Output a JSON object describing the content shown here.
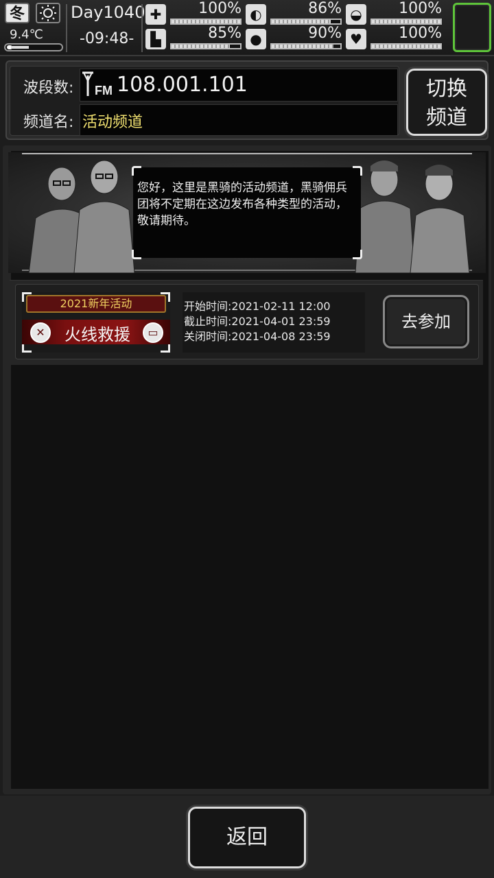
{
  "status": {
    "season": "冬",
    "weather_icon": "sun-icon",
    "temperature": "9.4℃",
    "thermometer_level": 0.3,
    "day": "Day1040",
    "time": "-09:48-",
    "stats": [
      {
        "name": "health",
        "icon": "first-aid-icon",
        "glyph": "✚",
        "value": "100%",
        "level": 1.0
      },
      {
        "name": "hunger",
        "icon": "stomach-icon",
        "glyph": "◐",
        "value": "86%",
        "level": 0.86
      },
      {
        "name": "medicine",
        "icon": "pill-icon",
        "glyph": "◒",
        "value": "100%",
        "level": 1.0
      },
      {
        "name": "stamina",
        "icon": "foot-icon",
        "glyph": "▙",
        "value": "85%",
        "level": 0.85
      },
      {
        "name": "thirst",
        "icon": "water-drop-icon",
        "glyph": "●",
        "value": "90%",
        "level": 0.9
      },
      {
        "name": "mood",
        "icon": "heart-icon",
        "glyph": "♥",
        "value": "100%",
        "level": 1.0
      }
    ]
  },
  "radio": {
    "band_label": "波段数:",
    "frequency": "108.001.101",
    "channel_label": "频道名:",
    "channel_name": "活动频道",
    "switch_line1": "切换",
    "switch_line2": "频道"
  },
  "banner": {
    "message": "您好，这里是黑骑的活动频道，黑骑佣兵团将不定期在这边发布各种类型的活动，敬请期待。"
  },
  "event": {
    "tag": "2021新年活动",
    "name": "火线救援",
    "start": "开始时间:2021-02-11 12:00",
    "end": "截止时间:2021-04-01 23:59",
    "close": "关闭时间:2021-04-08 23:59",
    "join_label": "去参加"
  },
  "footer": {
    "back_label": "返回"
  },
  "colors": {
    "accent_green": "#5ec43a",
    "channel_yellow": "#f0e070",
    "event_red": "#8a1414",
    "event_gold": "#f0d060"
  }
}
